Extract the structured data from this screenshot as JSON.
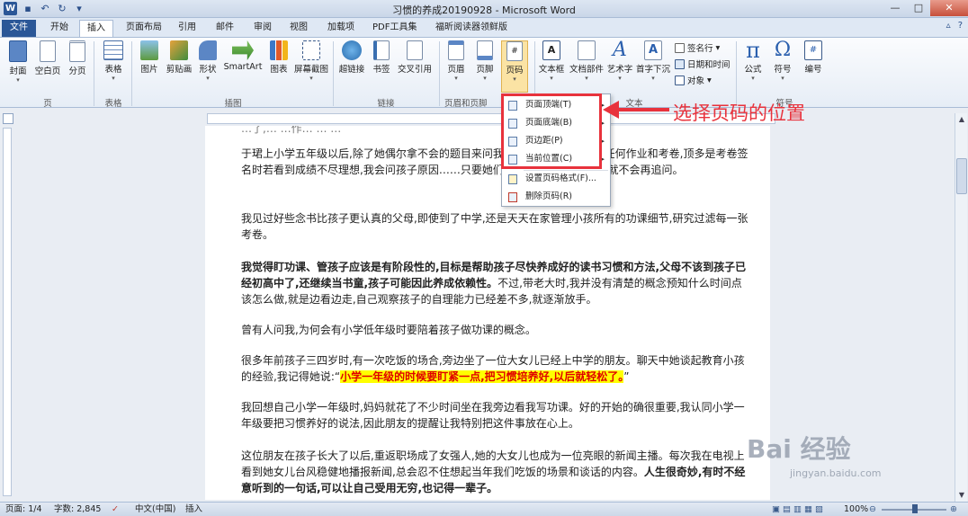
{
  "window": {
    "title": "习惯的养成20190928 - Microsoft Word"
  },
  "tabs": [
    {
      "label": "文件"
    },
    {
      "label": "开始"
    },
    {
      "label": "插入"
    },
    {
      "label": "页面布局"
    },
    {
      "label": "引用"
    },
    {
      "label": "邮件"
    },
    {
      "label": "审阅"
    },
    {
      "label": "视图"
    },
    {
      "label": "加载项"
    },
    {
      "label": "PDF工具集"
    },
    {
      "label": "福昕阅读器领鲜版"
    }
  ],
  "ribbon": {
    "groups": {
      "pages": "页",
      "tables": "表格",
      "illustrations": "插图",
      "links": "链接",
      "header_footer": "页眉和页脚",
      "text": "文本",
      "symbols": "符号"
    },
    "buttons": {
      "cover": "封面",
      "blank_page": "空白页",
      "page_break": "分页",
      "table": "表格",
      "picture": "图片",
      "clip_art": "剪贴画",
      "shapes": "形状",
      "smartart": "SmartArt",
      "chart": "图表",
      "screenshot": "屏幕截图",
      "hyperlink": "超链接",
      "bookmark": "书签",
      "cross_ref": "交叉引用",
      "header": "页眉",
      "footer": "页脚",
      "page_number": "页码",
      "textbox": "文本框",
      "quick_parts": "文档部件",
      "wordart": "艺术字",
      "dropcap": "首字下沉",
      "signature": "签名行",
      "datetime": "日期和时间",
      "object": "对象",
      "equation": "公式",
      "symbol": "符号",
      "number": "编号"
    }
  },
  "menu": {
    "items": [
      {
        "label": "页面顶端(T)"
      },
      {
        "label": "页面底端(B)"
      },
      {
        "label": "页边距(P)"
      },
      {
        "label": "当前位置(C)"
      },
      {
        "label": "设置页码格式(F)..."
      },
      {
        "label": "删除页码(R)"
      }
    ]
  },
  "annotation": {
    "callout": "选择页码的位置"
  },
  "document": {
    "p0": "…了,… …作… … …",
    "p1": "于珺上小学五年级以后,除了她偶尔拿不会的题目来问我,我几乎没有主动看过任何作业和考卷,顶多是考卷签名时若看到成绩不尽理想,我会问孩子原因……只要她们说没问题,我信任他们,就不会再追问。",
    "p2": "我见过好些念书比孩子更认真的父母,即使到了中学,还是天天在家管理小孩所有的功课细节,研究过滤每一张考卷。",
    "p3_bold": "我觉得盯功课、管孩子应该是有阶段性的,目标是帮助孩子尽快养成好的读书习惯和方法,父母不该到孩子已经初高中了,还继续当书童,孩子可能因此养成依赖性。",
    "p3_rest": "不过,带老大时,我并没有清楚的概念预知什么时间点该怎么做,就是边看边走,自己观察孩子的自理能力已经差不多,就逐渐放手。",
    "p4": "曾有人问我,为何会有小学低年级时要陪着孩子做功课的概念。",
    "p5_pre": "很多年前孩子三四岁时,有一次吃饭的场合,旁边坐了一位大女儿已经上中学的朋友。聊天中她谈起教育小孩的经验,我记得她说:“",
    "p5_hl": "小学一年级的时候要盯紧一点,把习惯培养好,以后就轻松了。",
    "p5_post": "”",
    "p6": "我回想自己小学一年级时,妈妈就花了不少时间坐在我旁边看我写功课。好的开始的确很重要,我认同小学一年级要把习惯养好的说法,因此朋友的提醒让我特别把这件事放在心上。",
    "p7_pre": "这位朋友在孩子长大了以后,重返职场成了女强人,她的大女儿也成为一位亮眼的新闻主播。每次我在电视上看到她女儿台风稳健地播报新闻,总会忍不住想起当年我们吃饭的场景和谈话的内容。",
    "p7_bold": "人生很奇妙,有时不经意听到的一句话,可以让自己受用无穷,也记得一辈子。"
  },
  "statusbar": {
    "page": "页面: 1/4",
    "words": "字数: 2,845",
    "language": "中文(中国)",
    "mode": "插入",
    "zoom": "100%"
  },
  "watermark": {
    "brand": "Bai 经验",
    "url": "jingyan.baidu.com"
  },
  "colors": {
    "accent_red": "#e8323c",
    "file_tab": "#2b5797",
    "highlight": "#ffff00"
  }
}
